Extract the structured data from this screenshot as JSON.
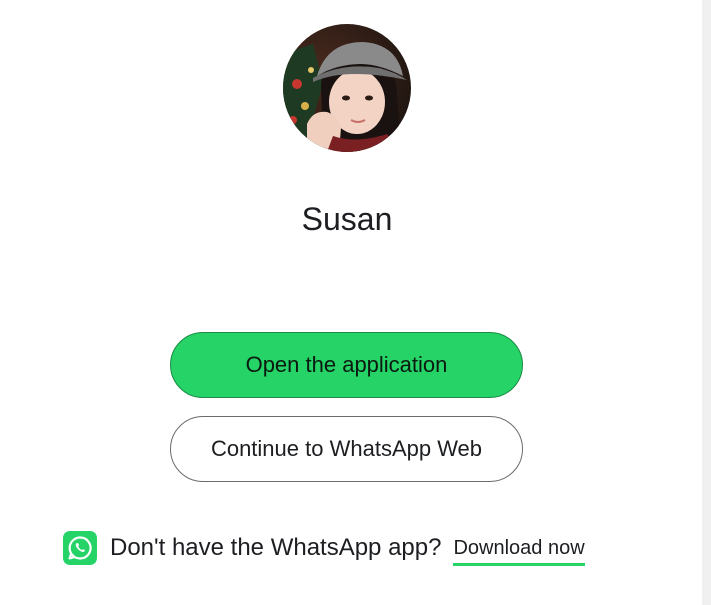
{
  "profile": {
    "name": "Susan",
    "avatar": "profile-photo"
  },
  "actions": {
    "open_app_label": "Open the application",
    "continue_web_label": "Continue to WhatsApp Web"
  },
  "footer": {
    "icon": "whatsapp-icon",
    "prompt_text": "Don't have the WhatsApp app?",
    "download_label": "Download now"
  },
  "colors": {
    "brand_green": "#25d366",
    "text": "#1c1e21",
    "outline": "#6b6b6b",
    "background": "#ffffff"
  }
}
